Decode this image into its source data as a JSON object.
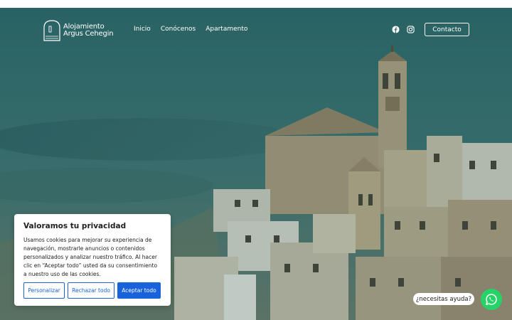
{
  "site": {
    "logo_line1": "Alojamiento",
    "logo_line2": "Argus Cehegin"
  },
  "nav": {
    "items": [
      "Inicio",
      "Conócenos",
      "Apartamento"
    ],
    "contact_label": "Contacto"
  },
  "social": {
    "icons": [
      "facebook-icon",
      "instagram-icon"
    ]
  },
  "cookie_banner": {
    "title": "Valoramos tu privacidad",
    "body": "Usamos cookies para mejorar su experiencia de navegación, mostrarle anuncios o contenidos personalizados y analizar nuestro tráfico. Al hacer clic en “Aceptar todo” usted da su consentimiento a nuestro uso de las cookies.",
    "customize_label": "Personalizar",
    "reject_label": "Rechazar todo",
    "accept_label": "Aceptar todo"
  },
  "whatsapp": {
    "bubble_text": "¿necesitas ayuda?",
    "icon": "whatsapp-icon"
  },
  "colors": {
    "accent": "#1863dc",
    "whatsapp": "#25d366",
    "hero_tint": "#2f6466"
  }
}
